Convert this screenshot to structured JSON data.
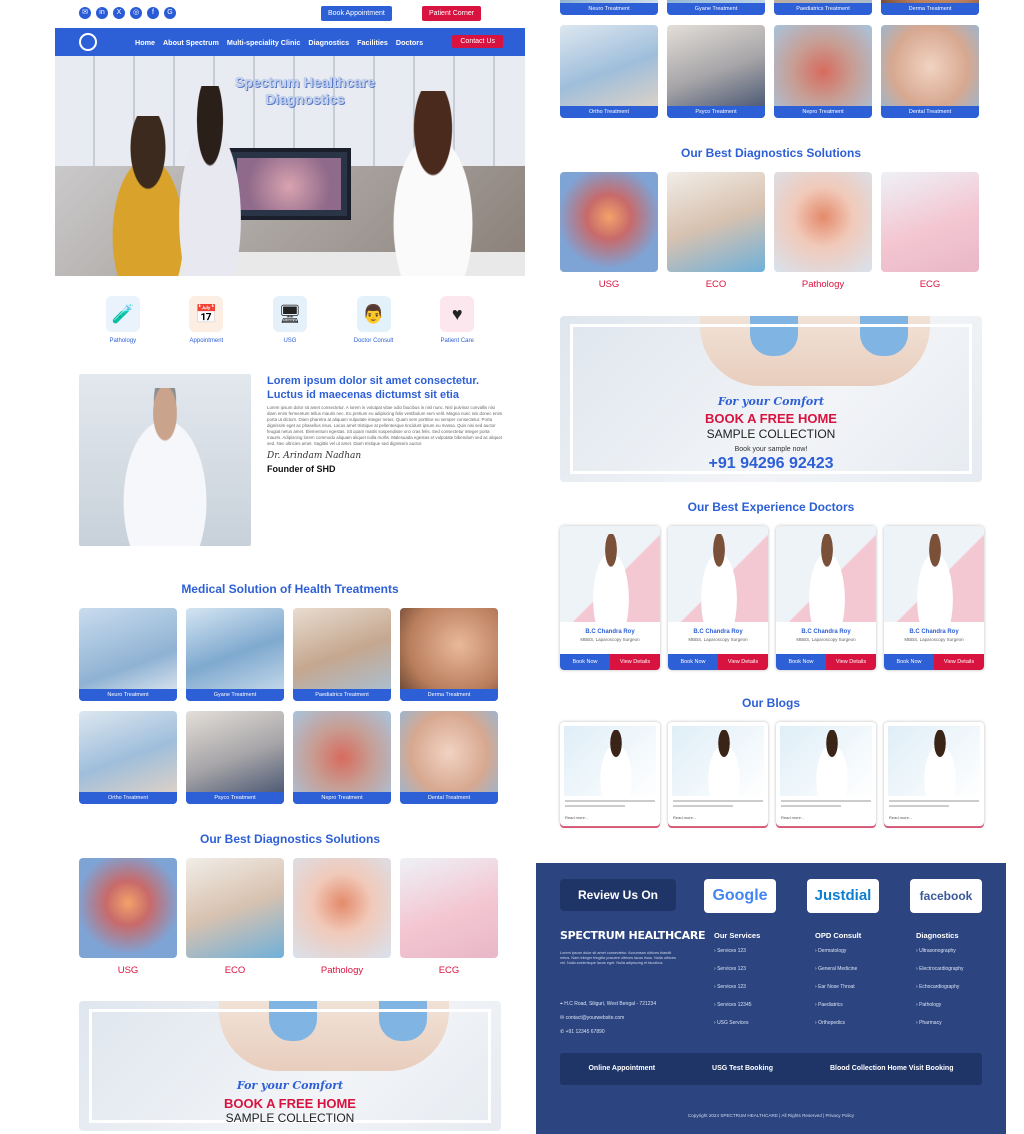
{
  "header": {
    "social_icons": [
      "envelope-icon",
      "linkedin-icon",
      "x-icon",
      "instagram-icon",
      "facebook-icon",
      "google-icon"
    ],
    "book_appointment": "Book Appointment",
    "patient_corner": "Patient Corner"
  },
  "nav": {
    "items": [
      "Home",
      "About Spectrum",
      "Multi-speciality Clinic",
      "Diagnostics",
      "Facilities",
      "Doctors"
    ],
    "contact": "Contact Us"
  },
  "hero": {
    "title_line1": "Spectrum Healthcare",
    "title_line2": "Diagnostics"
  },
  "quick_links": [
    {
      "label": "Pathology",
      "icon": "test-tube-icon"
    },
    {
      "label": "Appointment",
      "icon": "calendar-icon"
    },
    {
      "label": "USG",
      "icon": "ultrasound-machine-icon"
    },
    {
      "label": "Doctor Consult",
      "icon": "doctor-icon"
    },
    {
      "label": "Patient Care",
      "icon": "heart-hands-icon"
    }
  ],
  "about": {
    "heading": "Lorem ipsum dolor sit amet consectetur. Luctus id maecenas dictumst sit etia",
    "body": "Lorem ipsum dolor sit amet consectetur. A lorem in volutpat vitae odio faucibus in nisl nunc. Nisl pulvinar convallis nisi diam enim fermentum tellus mauris nec. Eu pretium eu adipiscing felis vestibulum sem velit. Magna nunc nisi donec enim porta ut dictum. Diam pharetra at aliquam vulputate integer netus. Quam sem porttitor eu semper consectetur. Porta dignissim eget ac phasellus risus. Lacus amet tristique at pellentesque tincidunt ipsum eu massa. Quis nisi sed auctor feugiat netus amet. Elementum egestas. Sit quam mattis suspendisse orci cras felis. Sed consectetur integer porta mauris. Adipiscing lorem commodo aliquam aliquet nulla mollis. Malesuada egestas et vulputate bibendum sed ac aliquet sed. Nec ultricies amet. Sagittis vel ut amet. Diam tristique sed dignissim auctor.",
    "signature": "Dr. Arindam Nadhan",
    "founder": "Founder of SHD"
  },
  "treatments": {
    "heading": "Medical Solution of Health Treatments",
    "items": [
      "Neuro Treatment",
      "Gyane Treatment",
      "Paediatrics Treatment",
      "Derma Treatment",
      "Ortho Treatment",
      "Psyco Treatment",
      "Nepro Treatment",
      "Dental Treatment"
    ]
  },
  "diagnostics": {
    "heading": "Our Best Diagnostics Solutions",
    "items": [
      "USG",
      "ECO",
      "Pathology",
      "ECG"
    ]
  },
  "banner": {
    "tagline": "For your Comfort",
    "headline": "BOOK A FREE HOME",
    "subhead": "SAMPLE COLLECTION",
    "cta": "Book your sample now!",
    "phone": "+91 94296 92423"
  },
  "doctors": {
    "heading": "Our Best Experience Doctors",
    "items": [
      {
        "name": "B.C Chandra Roy",
        "degree": "MBBS, Laparoscopy Surgeon"
      },
      {
        "name": "B.C Chandra Roy",
        "degree": "MBBS, Laparoscopy Surgeon"
      },
      {
        "name": "B.C Chandra Roy",
        "degree": "MBBS, Laparoscopy Surgeon"
      },
      {
        "name": "B.C Chandra Roy",
        "degree": "MBBS, Laparoscopy Surgeon"
      }
    ],
    "book_label": "Book Now",
    "view_label": "View Details"
  },
  "blogs": {
    "heading": "Our Blogs",
    "read_more": "Read more..."
  },
  "footer": {
    "review_label": "Review Us On",
    "review_logos": [
      "Google",
      "Justdial",
      "facebook"
    ],
    "brand": "SPECTRUM HEALTHCARE",
    "address": "H.C Road, Siliguri, West Bengal - 721234",
    "email": "contact@yourwebsite.com",
    "phone": "+91 12345 67890",
    "columns": [
      {
        "title": "Our Services",
        "items": [
          "Services 123",
          "Services 123",
          "Services 123",
          "Services 12345",
          "USG Services"
        ]
      },
      {
        "title": "OPD Consult",
        "items": [
          "Dermatology",
          "General Medicine",
          "Ear Nose Throat",
          "Paediatrics",
          "Orthopedics"
        ]
      },
      {
        "title": "Diagnostics",
        "items": [
          "Ultrasonography",
          "Electrocardiography",
          "Echocardiography",
          "Pathology",
          "Pharmacy"
        ]
      }
    ],
    "bar_links": [
      "Online Appointment",
      "USG Test Booking",
      "Blood Collection Home Visit Booking"
    ],
    "copyright": "Copyright 2024 SPECTRUM HEALTHCARE | All Rights Reserved | Privacy Policy"
  }
}
